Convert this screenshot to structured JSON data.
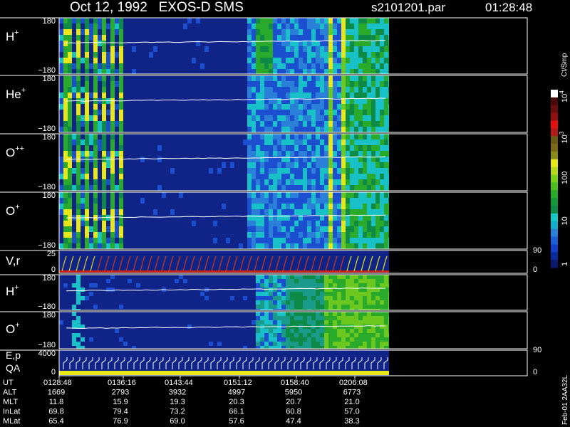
{
  "header": {
    "title": "Oct 12, 1992   EXOS-D SMS",
    "file": "s2101201.par",
    "time": "01:28:48"
  },
  "colorbar": {
    "unit_label": "Ct/Smp",
    "ticks": [
      "1",
      "10",
      "100",
      "10",
      "10"
    ],
    "tick_exponents": [
      "",
      "",
      "",
      "3",
      "4"
    ],
    "colors": [
      "#0a1a6e",
      "#0a2a9e",
      "#1340c8",
      "#1b5fd6",
      "#2a7fd8",
      "#12b0c8",
      "#16c8c8",
      "#0d8a46",
      "#129a3a",
      "#2aaa2a",
      "#4cc01e",
      "#7ad018",
      "#b8d818",
      "#e8e818",
      "#8a8a18",
      "#7a6a18",
      "#6a5a14",
      "#b41818",
      "#e81010",
      "#901010",
      "#6a0e0e",
      "#4a0a0a",
      "#ffffff"
    ]
  },
  "panels": [
    {
      "label": "H",
      "sup": "+",
      "top": "180",
      "bottom": "−180"
    },
    {
      "label": "He",
      "sup": "+",
      "top": "180",
      "bottom": "−180"
    },
    {
      "label": "O",
      "sup": "++",
      "top": "180",
      "bottom": "−180"
    },
    {
      "label": "O",
      "sup": "+",
      "top": "180",
      "bottom": "−180"
    },
    {
      "label": "V,r",
      "sup": "",
      "top": "25",
      "bottom": "0",
      "right_top": "90",
      "right_bottom": "0"
    },
    {
      "label": "H",
      "sup": "+",
      "top": "180",
      "bottom": "−180"
    },
    {
      "label": "O",
      "sup": "+",
      "top": "180",
      "bottom": "−180"
    },
    {
      "label": "E,p",
      "label2": "QA",
      "sup": "",
      "top": "4000",
      "bottom": "0",
      "right_top": "90",
      "right_bottom": "0"
    }
  ],
  "footer": {
    "rows": [
      {
        "name": "UT",
        "values": [
          "0128:48",
          "0136:16",
          "0143:44",
          "0151:12",
          "0158:40",
          "0206:08"
        ]
      },
      {
        "name": "ALT",
        "values": [
          "1669",
          "2793",
          "3932",
          "4997",
          "5950",
          "6773"
        ]
      },
      {
        "name": "MLT",
        "values": [
          "11.8",
          "15.9",
          "19.3",
          "20.3",
          "20.7",
          "21.0"
        ]
      },
      {
        "name": "InLat",
        "values": [
          "69.8",
          "79.4",
          "73.2",
          "66.1",
          "60.8",
          "57.0"
        ]
      },
      {
        "name": "MLat",
        "values": [
          "65.4",
          "76.9",
          "69.0",
          "57.6",
          "47.4",
          "38.3"
        ]
      }
    ],
    "stamp": "Feb-01 2AA32L"
  },
  "chart_data": {
    "type": "heatmap",
    "title": "Oct 12, 1992   EXOS-D SMS",
    "x": [
      "0128:48",
      "0136:16",
      "0143:44",
      "0151:12",
      "0158:40",
      "0206:08"
    ],
    "xlabel": "UT",
    "series": [
      {
        "name": "H+",
        "ylim": [
          -180,
          180
        ]
      },
      {
        "name": "He+",
        "ylim": [
          -180,
          180
        ]
      },
      {
        "name": "O++",
        "ylim": [
          -180,
          180
        ]
      },
      {
        "name": "O+",
        "ylim": [
          -180,
          180
        ]
      },
      {
        "name": "V,r",
        "ylim": [
          0,
          25
        ],
        "right_ylim": [
          0,
          90
        ]
      },
      {
        "name": "H+",
        "ylim": [
          -180,
          180
        ]
      },
      {
        "name": "O+",
        "ylim": [
          -180,
          180
        ]
      },
      {
        "name": "E,p QA",
        "ylim": [
          0,
          4000
        ],
        "right_ylim": [
          0,
          90
        ]
      }
    ],
    "colorscale": {
      "label": "Ct/Smp",
      "ticks": [
        "1",
        "10",
        "100",
        "10^3",
        "10^4"
      ],
      "log": true
    }
  }
}
